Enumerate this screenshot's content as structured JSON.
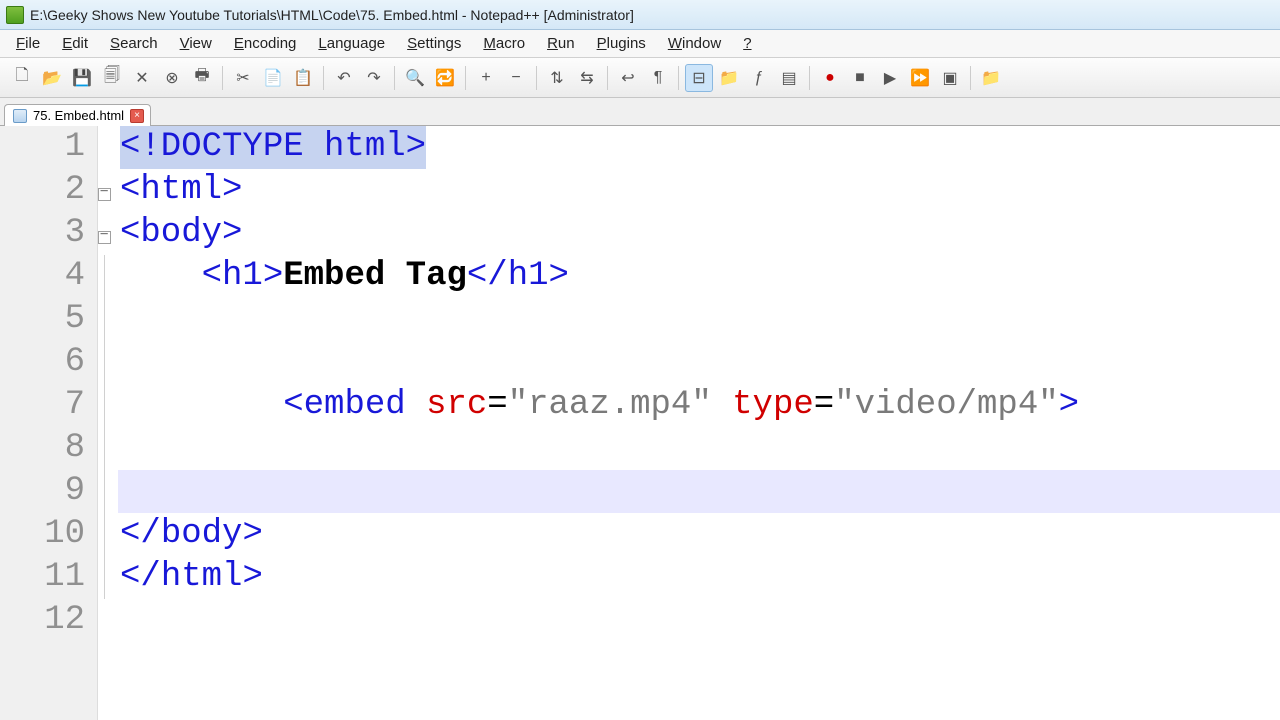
{
  "window": {
    "title": "E:\\Geeky Shows New Youtube Tutorials\\HTML\\Code\\75. Embed.html - Notepad++ [Administrator]"
  },
  "menubar": {
    "items": [
      "File",
      "Edit",
      "Search",
      "View",
      "Encoding",
      "Language",
      "Settings",
      "Macro",
      "Run",
      "Plugins",
      "Window",
      "?"
    ]
  },
  "toolbar": {
    "icons": [
      {
        "name": "new-file-icon",
        "glyph": "🗋"
      },
      {
        "name": "open-file-icon",
        "glyph": "📂"
      },
      {
        "name": "save-icon",
        "glyph": "💾"
      },
      {
        "name": "copy-save-icon",
        "glyph": "🗐"
      },
      {
        "name": "close-icon",
        "glyph": "✕"
      },
      {
        "name": "close-all-icon",
        "glyph": "⊗"
      },
      {
        "name": "print-icon",
        "glyph": "🖶"
      },
      {
        "sep": true
      },
      {
        "name": "cut-icon",
        "glyph": "✂"
      },
      {
        "name": "copy-icon",
        "glyph": "📄"
      },
      {
        "name": "paste-icon",
        "glyph": "📋"
      },
      {
        "sep": true
      },
      {
        "name": "undo-icon",
        "glyph": "↶"
      },
      {
        "name": "redo-icon",
        "glyph": "↷"
      },
      {
        "sep": true
      },
      {
        "name": "find-icon",
        "glyph": "🔍"
      },
      {
        "name": "replace-icon",
        "glyph": "🔁"
      },
      {
        "sep": true
      },
      {
        "name": "zoom-in-icon",
        "glyph": "+"
      },
      {
        "name": "zoom-out-icon",
        "glyph": "−"
      },
      {
        "sep": true
      },
      {
        "name": "sync-v-icon",
        "glyph": "⇅"
      },
      {
        "name": "sync-h-icon",
        "glyph": "⇆"
      },
      {
        "sep": true
      },
      {
        "name": "wrap-icon",
        "glyph": "↩"
      },
      {
        "name": "pilcrow-icon",
        "glyph": "¶"
      },
      {
        "sep": true
      },
      {
        "name": "indent-guide-icon",
        "glyph": "⊟",
        "active": true
      },
      {
        "name": "folder-icon",
        "glyph": "📁"
      },
      {
        "name": "function-list-icon",
        "glyph": "ƒ"
      },
      {
        "name": "doc-map-icon",
        "glyph": "▤"
      },
      {
        "sep": true
      },
      {
        "name": "record-icon",
        "glyph": "●",
        "color": "#c00"
      },
      {
        "name": "stop-icon",
        "glyph": "■"
      },
      {
        "name": "play-icon",
        "glyph": "▶"
      },
      {
        "name": "fast-play-icon",
        "glyph": "⏩"
      },
      {
        "name": "save-macro-icon",
        "glyph": "▣"
      },
      {
        "sep": true
      },
      {
        "name": "explorer-icon",
        "glyph": "📁"
      }
    ]
  },
  "tabs": {
    "items": [
      {
        "label": "75. Embed.html"
      }
    ]
  },
  "editor": {
    "line_count": 12,
    "current_line": 9,
    "lines": [
      {
        "num": 1,
        "tokens": [
          {
            "t": "doctype",
            "v": "<!DOCTYPE html>"
          }
        ]
      },
      {
        "num": 2,
        "fold": "box",
        "tokens": [
          {
            "t": "ang",
            "v": "<"
          },
          {
            "t": "tag",
            "v": "html"
          },
          {
            "t": "ang",
            "v": ">"
          }
        ]
      },
      {
        "num": 3,
        "fold": "box",
        "tokens": [
          {
            "t": "ang",
            "v": "<"
          },
          {
            "t": "tag",
            "v": "body"
          },
          {
            "t": "ang",
            "v": ">"
          }
        ]
      },
      {
        "num": 4,
        "indent": 2,
        "tokens": [
          {
            "t": "ang",
            "v": "<"
          },
          {
            "t": "tag",
            "v": "h1"
          },
          {
            "t": "ang",
            "v": ">"
          },
          {
            "t": "text",
            "v": "Embed Tag"
          },
          {
            "t": "ang",
            "v": "</"
          },
          {
            "t": "tag",
            "v": "h1"
          },
          {
            "t": "ang",
            "v": ">"
          }
        ]
      },
      {
        "num": 5,
        "tokens": []
      },
      {
        "num": 6,
        "tokens": []
      },
      {
        "num": 7,
        "indent": 4,
        "tokens": [
          {
            "t": "ang",
            "v": "<"
          },
          {
            "t": "tag",
            "v": "embed"
          },
          {
            "t": "plain",
            "v": " "
          },
          {
            "t": "attr",
            "v": "src"
          },
          {
            "t": "plain",
            "v": "="
          },
          {
            "t": "str",
            "v": "\"raaz.mp4\""
          },
          {
            "t": "plain",
            "v": " "
          },
          {
            "t": "attr",
            "v": "type"
          },
          {
            "t": "plain",
            "v": "="
          },
          {
            "t": "str",
            "v": "\"video/mp4\""
          },
          {
            "t": "ang",
            "v": ">"
          }
        ]
      },
      {
        "num": 8,
        "tokens": []
      },
      {
        "num": 9,
        "tokens": []
      },
      {
        "num": 10,
        "fold": "end",
        "tokens": [
          {
            "t": "ang",
            "v": "</"
          },
          {
            "t": "tag",
            "v": "body"
          },
          {
            "t": "ang",
            "v": ">"
          }
        ]
      },
      {
        "num": 11,
        "fold": "end",
        "tokens": [
          {
            "t": "ang",
            "v": "</"
          },
          {
            "t": "tag",
            "v": "html"
          },
          {
            "t": "ang",
            "v": ">"
          }
        ]
      },
      {
        "num": 12,
        "tokens": []
      }
    ]
  }
}
